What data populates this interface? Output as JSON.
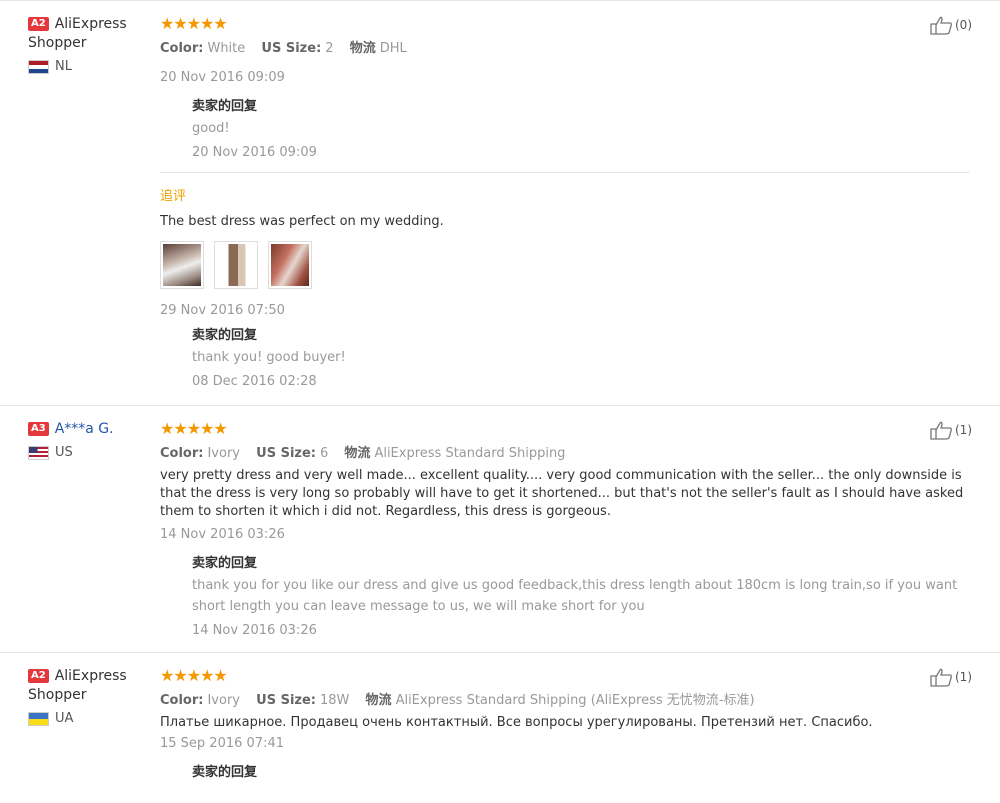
{
  "reviews": [
    {
      "level": "A2",
      "name_line1": "AliExpress",
      "name_line2": "Shopper",
      "country": "NL",
      "stars": "★★★★★",
      "color_label": "Color:",
      "color": "White",
      "size_label": "US Size:",
      "size": "2",
      "ship_label": "物流",
      "ship": "DHL",
      "date": "20 Nov 2016 09:09",
      "useful_count": "(0)",
      "reply": {
        "title": "卖家的回复",
        "body": "good!",
        "date": "20 Nov 2016 09:09"
      },
      "append": {
        "title": "追评",
        "text": "The best dress was perfect on my wedding.",
        "date": "29 Nov 2016 07:50",
        "reply": {
          "title": "卖家的回复",
          "body": "thank you! good buyer!",
          "date": "08 Dec 2016 02:28"
        }
      }
    },
    {
      "level": "A3",
      "name_line1": "A***a G.",
      "country": "US",
      "stars": "★★★★★",
      "color_label": "Color:",
      "color": "Ivory",
      "size_label": "US Size:",
      "size": "6",
      "ship_label": "物流",
      "ship": "AliExpress Standard Shipping",
      "text": "very pretty dress and very well made... excellent quality.... very good communication with the seller... the only downside is that the dress is very long so probably will have to get it shortened... but that's not the seller's fault as I should have asked them to shorten it which i did not. Regardless, this dress is gorgeous.",
      "date": "14 Nov 2016 03:26",
      "useful_count": "(1)",
      "reply": {
        "title": "卖家的回复",
        "body": "thank you for you like our dress and give us good feedback,this dress length about 180cm is long train,so if you want short length you can leave message to us, we will make short for you",
        "date": "14 Nov 2016 03:26"
      }
    },
    {
      "level": "A2",
      "name_line1": "AliExpress",
      "name_line2": "Shopper",
      "country": "UA",
      "stars": "★★★★★",
      "color_label": "Color:",
      "color": "Ivory",
      "size_label": "US Size:",
      "size": "18W",
      "ship_label": "物流",
      "ship": "AliExpress Standard Shipping (AliExpress 无忧物流-标准)",
      "text": "Платье шикарное. Продавец очень контактный. Все вопросы урегулированы. Претензий нет. Спасибо.",
      "date": "15 Sep 2016 07:41",
      "useful_count": "(1)",
      "reply": {
        "title": "卖家的回复"
      }
    }
  ]
}
